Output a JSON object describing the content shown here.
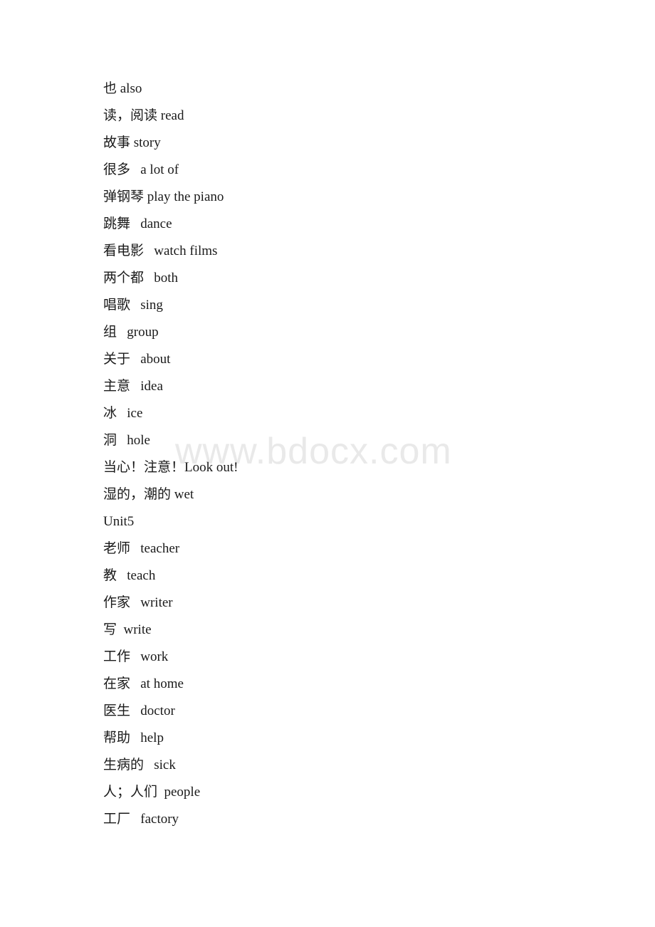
{
  "document": {
    "page_background": "#ffffff",
    "text_color": "#1a1a1a",
    "watermark": {
      "text": "www.bdocx.com",
      "color": "#e9e9e9"
    },
    "lines": [
      {
        "id": "also",
        "text": "也 also"
      },
      {
        "id": "read",
        "text": "读，阅读 read"
      },
      {
        "id": "story",
        "text": "故事 story"
      },
      {
        "id": "a-lot-of",
        "text": "很多   a lot of"
      },
      {
        "id": "play-piano",
        "text": "弹钢琴 play the piano"
      },
      {
        "id": "dance",
        "text": "跳舞   dance"
      },
      {
        "id": "watch-films",
        "text": "看电影   watch films"
      },
      {
        "id": "both",
        "text": "两个都   both"
      },
      {
        "id": "sing",
        "text": "唱歌   sing"
      },
      {
        "id": "group",
        "text": "组   group"
      },
      {
        "id": "about",
        "text": "关于   about"
      },
      {
        "id": "idea",
        "text": "主意   idea"
      },
      {
        "id": "ice",
        "text": "冰   ice"
      },
      {
        "id": "hole",
        "text": "洞   hole"
      },
      {
        "id": "look-out",
        "text": "当心！注意！Look out!"
      },
      {
        "id": "wet",
        "text": "湿的，潮的 wet"
      },
      {
        "id": "unit5-heading",
        "text": "Unit5"
      },
      {
        "id": "teacher",
        "text": "老师   teacher"
      },
      {
        "id": "teach",
        "text": "教   teach"
      },
      {
        "id": "writer",
        "text": "作家   writer"
      },
      {
        "id": "write",
        "text": "写  write"
      },
      {
        "id": "work",
        "text": "工作   work"
      },
      {
        "id": "at-home",
        "text": "在家   at home"
      },
      {
        "id": "doctor",
        "text": "医生   doctor"
      },
      {
        "id": "help",
        "text": "帮助   help"
      },
      {
        "id": "sick",
        "text": "生病的   sick"
      },
      {
        "id": "people",
        "text": "人；人们  people"
      },
      {
        "id": "factory",
        "text": "工厂   factory"
      }
    ]
  }
}
